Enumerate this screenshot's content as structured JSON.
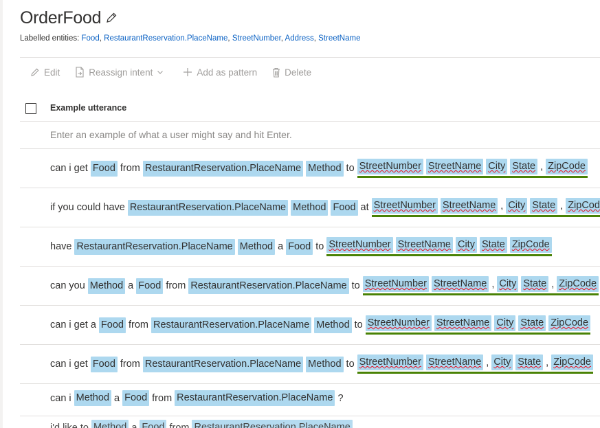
{
  "intent": {
    "title": "OrderFood",
    "labelled_prefix": "Labelled entities:",
    "labelled_entities": [
      "Food",
      "RestaurantReservation.PlaceName",
      "StreetNumber",
      "Address",
      "StreetName"
    ]
  },
  "toolbar": {
    "edit": "Edit",
    "reassign": "Reassign intent",
    "add_pattern": "Add as pattern",
    "delete": "Delete"
  },
  "table": {
    "header": "Example utterance",
    "input_placeholder": "Enter an example of what a user might say and hit Enter."
  },
  "colors": {
    "entity_chip": "#add8ef",
    "group_underline": "#498205",
    "link": "#0b62c4"
  },
  "utterances": [
    {
      "tokens": [
        {
          "t": "can i get"
        },
        {
          "e": "Food"
        },
        {
          "t": "from"
        },
        {
          "e": "RestaurantReservation.PlaceName"
        },
        {
          "e": "Method"
        },
        {
          "t": "to"
        },
        {
          "g": [
            {
              "e": "StreetNumber",
              "ul": true
            },
            {
              "e": "StreetName",
              "ul": true
            },
            {
              "e": "City",
              "ul": true
            },
            {
              "e": "State",
              "ul": true
            },
            {
              "p": ","
            },
            {
              "e": "ZipCode",
              "ul": true
            }
          ]
        }
      ]
    },
    {
      "tokens": [
        {
          "t": "if you could have"
        },
        {
          "e": "RestaurantReservation.PlaceName"
        },
        {
          "e": "Method"
        },
        {
          "e": "Food"
        },
        {
          "t": "at"
        },
        {
          "g": [
            {
              "e": "StreetNumber",
              "ul": true
            },
            {
              "e": "StreetName",
              "ul": true
            },
            {
              "p": ","
            },
            {
              "e": "City",
              "ul": true
            },
            {
              "e": "State",
              "ul": true
            },
            {
              "p": ","
            },
            {
              "e": "ZipCode",
              "ul": true
            }
          ]
        }
      ]
    },
    {
      "tokens": [
        {
          "t": "have"
        },
        {
          "e": "RestaurantReservation.PlaceName"
        },
        {
          "e": "Method"
        },
        {
          "t": "a"
        },
        {
          "e": "Food"
        },
        {
          "t": "to"
        },
        {
          "g": [
            {
              "e": "StreetNumber",
              "ul": true
            },
            {
              "e": "StreetName",
              "ul": true
            },
            {
              "e": "City",
              "ul": true
            },
            {
              "e": "State",
              "ul": true
            },
            {
              "e": "ZipCode",
              "ul": true
            }
          ]
        }
      ]
    },
    {
      "tokens": [
        {
          "t": "can you"
        },
        {
          "e": "Method"
        },
        {
          "t": "a"
        },
        {
          "e": "Food"
        },
        {
          "t": "from"
        },
        {
          "e": "RestaurantReservation.PlaceName"
        },
        {
          "t": "to"
        },
        {
          "g": [
            {
              "e": "StreetNumber",
              "ul": true
            },
            {
              "e": "StreetName",
              "ul": true
            },
            {
              "p": ","
            },
            {
              "e": "City",
              "ul": true
            },
            {
              "e": "State",
              "ul": true
            },
            {
              "p": ","
            },
            {
              "e": "ZipCode",
              "ul": true
            }
          ]
        }
      ]
    },
    {
      "tokens": [
        {
          "t": "can i get a"
        },
        {
          "e": "Food"
        },
        {
          "t": "from"
        },
        {
          "e": "RestaurantReservation.PlaceName"
        },
        {
          "e": "Method"
        },
        {
          "t": "to"
        },
        {
          "g": [
            {
              "e": "StreetNumber",
              "ul": true
            },
            {
              "e": "StreetName",
              "ul": true
            },
            {
              "e": "City",
              "ul": true
            },
            {
              "e": "State",
              "ul": true
            },
            {
              "e": "ZipCode",
              "ul": true
            }
          ]
        }
      ]
    },
    {
      "tokens": [
        {
          "t": "can i get"
        },
        {
          "e": "Food"
        },
        {
          "t": "from"
        },
        {
          "e": "RestaurantReservation.PlaceName"
        },
        {
          "e": "Method"
        },
        {
          "t": "to"
        },
        {
          "g": [
            {
              "e": "StreetNumber",
              "ul": true
            },
            {
              "e": "StreetName",
              "ul": true
            },
            {
              "p": ","
            },
            {
              "e": "City",
              "ul": true
            },
            {
              "e": "State",
              "ul": true
            },
            {
              "p": ","
            },
            {
              "e": "ZipCode",
              "ul": true
            }
          ]
        }
      ]
    },
    {
      "short": true,
      "tokens": [
        {
          "t": "can i"
        },
        {
          "e": "Method"
        },
        {
          "t": "a"
        },
        {
          "e": "Food"
        },
        {
          "t": "from"
        },
        {
          "e": "RestaurantReservation.PlaceName"
        },
        {
          "t": "?"
        }
      ]
    }
  ],
  "partial_utterance": {
    "tokens": [
      {
        "t": "i'd like to"
      },
      {
        "e": "Method"
      },
      {
        "t": "a"
      },
      {
        "e": "Food"
      },
      {
        "t": "from"
      },
      {
        "e": "RestaurantReservation.PlaceName"
      }
    ]
  }
}
